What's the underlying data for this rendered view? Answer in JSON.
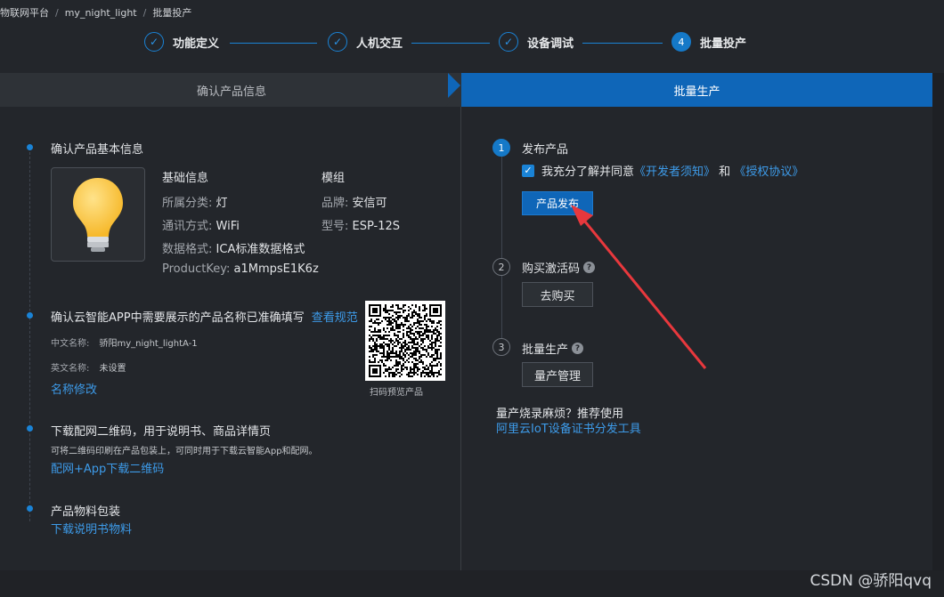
{
  "breadcrumb": [
    "物联网平台",
    "my_night_light",
    "批量投产"
  ],
  "steps": [
    {
      "label": "功能定义",
      "done": true
    },
    {
      "label": "人机交互",
      "done": true
    },
    {
      "label": "设备调试",
      "done": true
    },
    {
      "label": "批量投产",
      "number": "4",
      "done": false
    }
  ],
  "tabs": {
    "left": "确认产品信息",
    "right": "批量生产"
  },
  "left": {
    "section1": {
      "title": "确认产品基本信息",
      "basic_head": "基础信息",
      "module_head": "模组",
      "category_k": "所属分类:",
      "category_v": "灯",
      "comm_k": "通讯方式:",
      "comm_v": "WiFi",
      "format_k": "数据格式:",
      "format_v": "ICA标准数据格式",
      "key_k": "ProductKey:",
      "key_v": "a1MmpsE1K6z",
      "brand_k": "品牌:",
      "brand_v": "安信可",
      "model_k": "型号:",
      "model_v": "ESP-12S"
    },
    "section2": {
      "title": "确认云智能APP中需要展示的产品名称已准确填写",
      "link": "查看规范",
      "cn_k": "中文名称:",
      "cn_v": "骄阳my_night_lightA-1",
      "en_k": "英文名称:",
      "en_v": "未设置",
      "edit_link": "名称修改",
      "qr_caption": "扫码预览产品"
    },
    "section3": {
      "title": "下载配网二维码，用于说明书、商品详情页",
      "desc": "可将二维码印刷在产品包装上，可同时用于下载云智能App和配网。",
      "link": "配网+App下载二维码"
    },
    "section4": {
      "title": "产品物料包装",
      "link": "下载说明书物料"
    }
  },
  "right": {
    "step1": {
      "num": "1",
      "title": "发布产品",
      "agree_text": "我充分了解并同意",
      "doc1": "《开发者须知》",
      "and": "和",
      "doc2": "《授权协议》",
      "button": "产品发布"
    },
    "step2": {
      "num": "2",
      "title": "购买激活码",
      "button": "去购买"
    },
    "step3": {
      "num": "3",
      "title": "批量生产",
      "button": "量产管理"
    },
    "tip": "量产烧录麻烦？推荐使用",
    "tip_link": "阿里云IoT设备证书分发工具"
  },
  "watermark": "CSDN @骄阳qvq",
  "colors": {
    "accent": "#0f66b8",
    "link": "#3d9be9",
    "annotation_arrow": "#e8383d"
  }
}
